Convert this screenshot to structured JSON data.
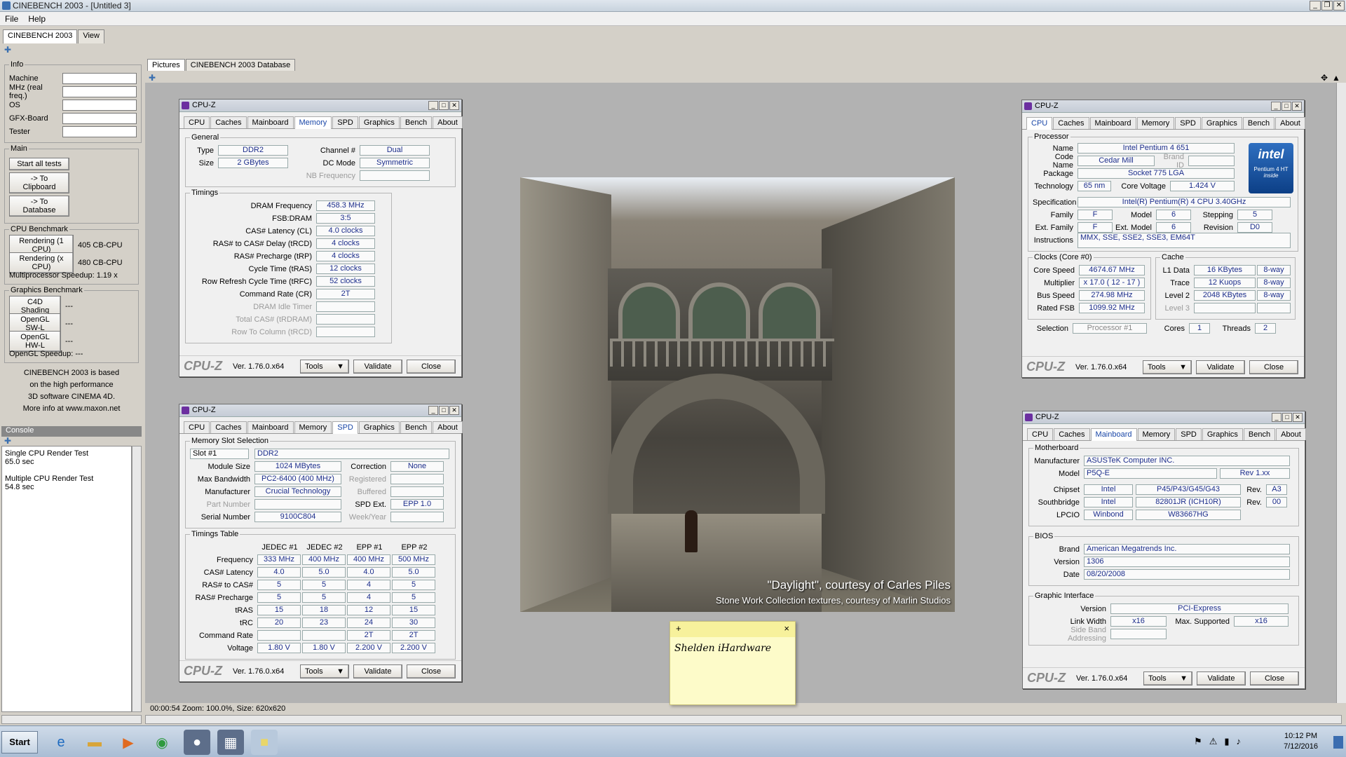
{
  "app": {
    "title": "CINEBENCH 2003 - [Untitled 3]",
    "menu": [
      "File",
      "Help"
    ],
    "tabs": [
      "CINEBENCH 2003",
      "View"
    ],
    "win_btns": [
      "_",
      "❐",
      "✕"
    ]
  },
  "info": {
    "legend": "Info",
    "fields": [
      "Machine",
      "MHz (real freq.)",
      "OS",
      "GFX-Board",
      "Tester"
    ]
  },
  "main": {
    "legend": "Main",
    "buttons": [
      "Start all tests",
      "-> To Clipboard",
      "-> To Database"
    ]
  },
  "cpu_bench": {
    "legend": "CPU Benchmark",
    "r1": "Rendering (1 CPU)",
    "r1_val": "405 CB-CPU",
    "rx": "Rendering (x CPU)",
    "rx_val": "480 CB-CPU",
    "speedup": "Multiprocessor Speedup:  1.19 x"
  },
  "gfx_bench": {
    "legend": "Graphics Benchmark",
    "b1": "C4D Shading",
    "b2": "OpenGL SW-L",
    "b3": "OpenGL HW-L",
    "dash": "---",
    "speedup": "OpenGL Speedup:  ---"
  },
  "about_text": [
    "CINEBENCH 2003 is based",
    "on the high performance",
    "3D software CINEMA 4D.",
    "More info at www.maxon.net"
  ],
  "console": {
    "title": "Console",
    "lines": [
      "Single CPU Render Test",
      "65.0 sec",
      "",
      "Multiple CPU Render Test",
      "54.8 sec"
    ]
  },
  "picture_tabs": [
    "Pictures",
    "CINEBENCH 2003 Database"
  ],
  "status": "00:00:54  Zoom: 100.0%, Size: 620x620",
  "image_caption": {
    "line1": "\"Daylight\", courtesy of Carles Piles",
    "line2": "Stone Work Collection textures, courtesy of Marlin Studios"
  },
  "note": {
    "plus": "+",
    "close": "×",
    "text": "Shelden iHardware"
  },
  "cpuz_common": {
    "title": "CPU-Z",
    "tabs": [
      "CPU",
      "Caches",
      "Mainboard",
      "Memory",
      "SPD",
      "Graphics",
      "Bench",
      "About"
    ],
    "logo": "CPU-Z",
    "version": "Ver. 1.76.0.x64",
    "tools": "Tools",
    "tools_arrow": "▼",
    "validate": "Validate",
    "close": "Close"
  },
  "memory": {
    "general": "General",
    "type_l": "Type",
    "type": "DDR2",
    "size_l": "Size",
    "size": "2 GBytes",
    "chan_l": "Channel #",
    "chan": "Dual",
    "dc_l": "DC Mode",
    "dc": "Symmetric",
    "nb_l": "NB Frequency",
    "timings": "Timings",
    "rows": [
      [
        "DRAM Frequency",
        "458.3 MHz"
      ],
      [
        "FSB:DRAM",
        "3:5"
      ],
      [
        "CAS# Latency (CL)",
        "4.0 clocks"
      ],
      [
        "RAS# to CAS# Delay (tRCD)",
        "4 clocks"
      ],
      [
        "RAS# Precharge (tRP)",
        "4 clocks"
      ],
      [
        "Cycle Time (tRAS)",
        "12 clocks"
      ],
      [
        "Row Refresh Cycle Time (tRFC)",
        "52 clocks"
      ],
      [
        "Command Rate (CR)",
        "2T"
      ],
      [
        "DRAM Idle Timer",
        ""
      ],
      [
        "Total CAS# (tRDRAM)",
        ""
      ],
      [
        "Row To Column (tRCD)",
        ""
      ]
    ]
  },
  "spd": {
    "slot_group": "Memory Slot Selection",
    "slot": "Slot #1",
    "slot_type": "DDR2",
    "rows": [
      [
        "Module Size",
        "1024 MBytes",
        "Correction",
        "None"
      ],
      [
        "Max Bandwidth",
        "PC2-6400 (400 MHz)",
        "Registered",
        ""
      ],
      [
        "Manufacturer",
        "Crucial Technology",
        "Buffered",
        ""
      ],
      [
        "Part Number",
        "",
        "SPD Ext.",
        "EPP 1.0"
      ],
      [
        "Serial Number",
        "9100C804",
        "Week/Year",
        ""
      ]
    ],
    "timings": "Timings Table",
    "cols": [
      "JEDEC #1",
      "JEDEC #2",
      "EPP #1",
      "EPP #2"
    ],
    "trows": [
      [
        "Frequency",
        "333 MHz",
        "400 MHz",
        "400 MHz",
        "500 MHz"
      ],
      [
        "CAS# Latency",
        "4.0",
        "5.0",
        "4.0",
        "5.0"
      ],
      [
        "RAS# to CAS#",
        "5",
        "5",
        "4",
        "5"
      ],
      [
        "RAS# Precharge",
        "5",
        "5",
        "4",
        "5"
      ],
      [
        "tRAS",
        "15",
        "18",
        "12",
        "15"
      ],
      [
        "tRC",
        "20",
        "23",
        "24",
        "30"
      ],
      [
        "Command Rate",
        "",
        "",
        "2T",
        "2T"
      ],
      [
        "Voltage",
        "1.80 V",
        "1.80 V",
        "2.200 V",
        "2.200 V"
      ]
    ]
  },
  "cpu": {
    "processor": "Processor",
    "name_l": "Name",
    "name": "Intel Pentium 4 651",
    "code_l": "Code Name",
    "code": "Cedar Mill",
    "brand_l": "Brand ID",
    "pkg_l": "Package",
    "pkg": "Socket 775 LGA",
    "tech_l": "Technology",
    "tech": "65 nm",
    "cv_l": "Core Voltage",
    "cv": "1.424 V",
    "spec_l": "Specification",
    "spec": "Intel(R) Pentium(R) 4 CPU 3.40GHz",
    "fam_l": "Family",
    "fam": "F",
    "model_l": "Model",
    "model": "6",
    "step_l": "Stepping",
    "step": "5",
    "efam_l": "Ext. Family",
    "efam": "F",
    "emodel_l": "Ext. Model",
    "emodel": "6",
    "rev_l": "Revision",
    "rev": "D0",
    "instr_l": "Instructions",
    "instr": "MMX, SSE, SSE2, SSE3, EM64T",
    "badge1": "intel",
    "badge2": "Pentium 4 HT",
    "badge3": "inside",
    "clocks": "Clocks (Core #0)",
    "cs_l": "Core Speed",
    "cs": "4674.67 MHz",
    "mul_l": "Multiplier",
    "mul": "x 17.0 ( 12 - 17 )",
    "bus_l": "Bus Speed",
    "bus": "274.98 MHz",
    "fsb_l": "Rated FSB",
    "fsb": "1099.92 MHz",
    "cache": "Cache",
    "l1_l": "L1 Data",
    "l1": "16 KBytes",
    "l1w": "8-way",
    "tr_l": "Trace",
    "tr": "12 Kuops",
    "trw": "8-way",
    "l2_l": "Level 2",
    "l2": "2048 KBytes",
    "l2w": "8-way",
    "l3_l": "Level 3",
    "sel_l": "Selection",
    "sel": "Processor #1",
    "cores_l": "Cores",
    "cores": "1",
    "threads_l": "Threads",
    "threads": "2"
  },
  "mb": {
    "mobo": "Motherboard",
    "man_l": "Manufacturer",
    "man": "ASUSTeK Computer INC.",
    "model_l": "Model",
    "model": "P5Q-E",
    "rev": "Rev 1.xx",
    "chip_l": "Chipset",
    "chip": "Intel",
    "chip2": "P45/P43/G45/G43",
    "chiprev_l": "Rev.",
    "chiprev": "A3",
    "sb_l": "Southbridge",
    "sb": "Intel",
    "sb2": "82801JR (ICH10R)",
    "sbrev": "00",
    "lpc_l": "LPCIO",
    "lpc": "Winbond",
    "lpc2": "W83667HG",
    "bios": "BIOS",
    "brand_l": "Brand",
    "brand": "American Megatrends Inc.",
    "ver_l": "Version",
    "ver": "1306",
    "date_l": "Date",
    "date": "08/20/2008",
    "gi": "Graphic Interface",
    "giv_l": "Version",
    "giv": "PCI-Express",
    "lw_l": "Link Width",
    "lw": "x16",
    "ms_l": "Max. Supported",
    "ms": "x16",
    "sba_l": "Side Band Addressing"
  },
  "taskbar": {
    "start": "Start",
    "time": "10:12 PM",
    "date": "7/12/2016"
  },
  "colors": {
    "value_text": "#1c2e8c",
    "tab_selected": "#1a47a8"
  }
}
